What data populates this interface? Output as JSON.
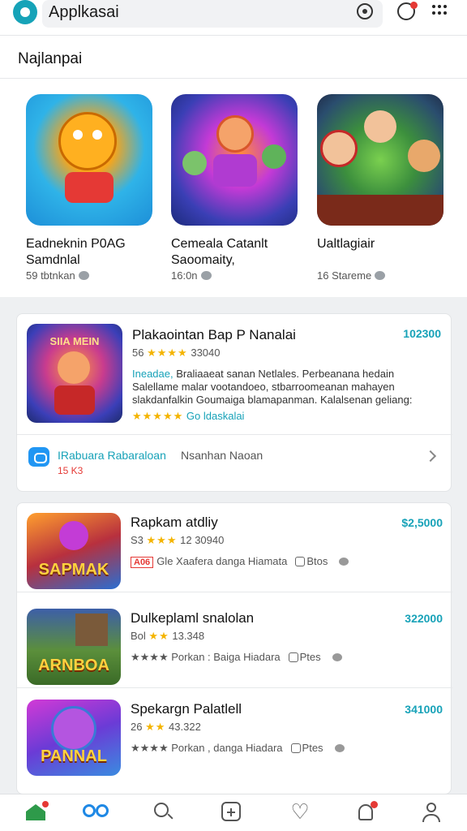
{
  "header": {
    "title": "Applkasai"
  },
  "featured": {
    "section_title": "Najlanpai",
    "cards": [
      {
        "name_line1": "Eadneknin P0AG",
        "name_line2": "Samdnlal",
        "meta": "59 tbtnkan"
      },
      {
        "name_line1": "Cemeala Catanlt",
        "name_line2": "Saoomaity,",
        "meta": "16:0n"
      },
      {
        "name_line1": "Ualtlagiair",
        "name_line2": "",
        "meta": "16 Stareme"
      }
    ]
  },
  "promo": {
    "art_banner": "SIIA MEIN",
    "title": "Plakaointan Bap P Nanalai",
    "price": "102300",
    "rating_prefix": "56",
    "rating_stars": "★★★★",
    "rating_suffix": "33040",
    "desc_lead": "Ineadae,",
    "desc_body": "Braliaaeat sanan Netlales. Perbeanana hedain Salellame malar vootandoeo, stbarroomeanan mahayen slakdanfalkin Goumaiga blamapanman. Kalalsenan geliang:",
    "stars2": "★★★★★",
    "stars2_label": "Go ldaskalai",
    "link_label": "IRabuara Rabaraloan",
    "link_sub": "15 K3",
    "link_secondary": "Nsanhan Naoan"
  },
  "apps": [
    {
      "art_word": "SAPMAK",
      "name": "Rapkam atdliy",
      "price": "$2,5000",
      "rating_prefix": "S3",
      "rating_stars": "★★★",
      "rating_suffix": "12 30940",
      "tag": "A06",
      "line3_text": "Gle Xaafera danga Hiamata",
      "line3_extra": "Btos"
    },
    {
      "art_word": "ARNBOA",
      "name": "Dulkeplaml snalolan",
      "price": "322000",
      "rating_prefix": "Bol",
      "rating_stars": "★★",
      "rating_suffix": "13.348",
      "tag": "",
      "line3_text": "★★★★  Porkan : Baiga Hiadara",
      "line3_extra": "Ptes"
    },
    {
      "art_word": "PANNAL",
      "name": "Spekargn Palatlell",
      "price": "341000",
      "rating_prefix": "26",
      "rating_stars": "★★",
      "rating_suffix": "43.322",
      "tag": "",
      "line3_text": "★★★★  Porkan , danga Hiadara",
      "line3_extra": "Ptes"
    }
  ],
  "colors": {
    "accent": "#17a2b8",
    "star": "#f4b400",
    "alert": "#e53935"
  }
}
